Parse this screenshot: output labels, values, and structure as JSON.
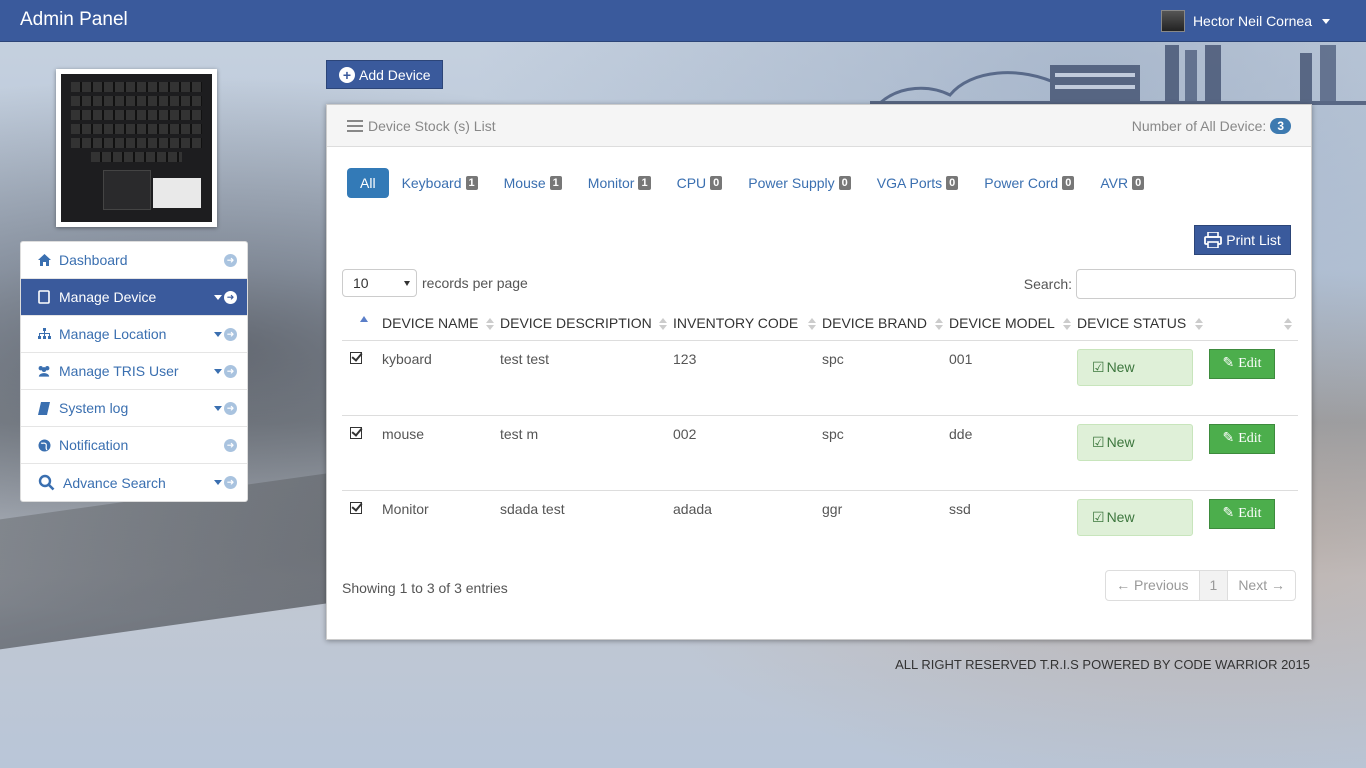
{
  "app": {
    "title": "Admin Panel"
  },
  "user": {
    "name": "Hector Neil Cornea"
  },
  "sidebar": {
    "items": [
      {
        "label": "Dashboard",
        "icon": "home-icon",
        "active": false,
        "dropdown": false
      },
      {
        "label": "Manage Device",
        "icon": "tablet-icon",
        "active": true,
        "dropdown": true
      },
      {
        "label": "Manage Location",
        "icon": "sitemap-icon",
        "active": false,
        "dropdown": true
      },
      {
        "label": "Manage TRIS User",
        "icon": "users-icon",
        "active": false,
        "dropdown": true
      },
      {
        "label": "System log",
        "icon": "book-icon",
        "active": false,
        "dropdown": true
      },
      {
        "label": "Notification",
        "icon": "globe-icon",
        "active": false,
        "dropdown": false
      },
      {
        "label": "Advance Search",
        "icon": "search-icon",
        "active": false,
        "dropdown": true
      }
    ]
  },
  "toolbar": {
    "add_device_label": "Add Device"
  },
  "panel": {
    "title": "Device Stock (s) List",
    "count_label": "Number of All Device:",
    "count_value": "3"
  },
  "filters": [
    {
      "label": "All",
      "count": null,
      "active": true
    },
    {
      "label": "Keyboard",
      "count": "1"
    },
    {
      "label": "Mouse",
      "count": "1"
    },
    {
      "label": "Monitor",
      "count": "1"
    },
    {
      "label": "CPU",
      "count": "0"
    },
    {
      "label": "Power Supply",
      "count": "0"
    },
    {
      "label": "VGA Ports",
      "count": "0"
    },
    {
      "label": "Power Cord",
      "count": "0"
    },
    {
      "label": "AVR",
      "count": "0"
    }
  ],
  "print_label": "Print List",
  "table_controls": {
    "per_page_value": "10",
    "per_page_label": "records per page",
    "search_label": "Search:"
  },
  "table": {
    "headers": [
      "DEVICE NAME",
      "DEVICE DESCRIPTION",
      "INVENTORY CODE",
      "DEVICE BRAND",
      "DEVICE MODEL",
      "DEVICE STATUS"
    ],
    "rows": [
      {
        "name": "kyboard",
        "description": "test test",
        "code": "123",
        "brand": "spc",
        "model": "001",
        "status": "New",
        "action": "Edit"
      },
      {
        "name": "mouse",
        "description": "test m",
        "code": "002",
        "brand": "spc",
        "model": "dde",
        "status": "New",
        "action": "Edit"
      },
      {
        "name": "Monitor",
        "description": "sdada test",
        "code": "adada",
        "brand": "ggr",
        "model": "ssd",
        "status": "New",
        "action": "Edit"
      }
    ]
  },
  "pagination": {
    "info": "Showing 1 to 3 of 3 entries",
    "previous": "← Previous",
    "current": "1",
    "next": "Next →"
  },
  "footer": {
    "text": "ALL RIGHT RESERVED T.R.I.S POWERED BY CODE WARRIOR 2015"
  },
  "colors": {
    "primary": "#3a5a9c",
    "link": "#3a6fb0",
    "success": "#4cae4c",
    "status_bg": "#dff0d8"
  }
}
